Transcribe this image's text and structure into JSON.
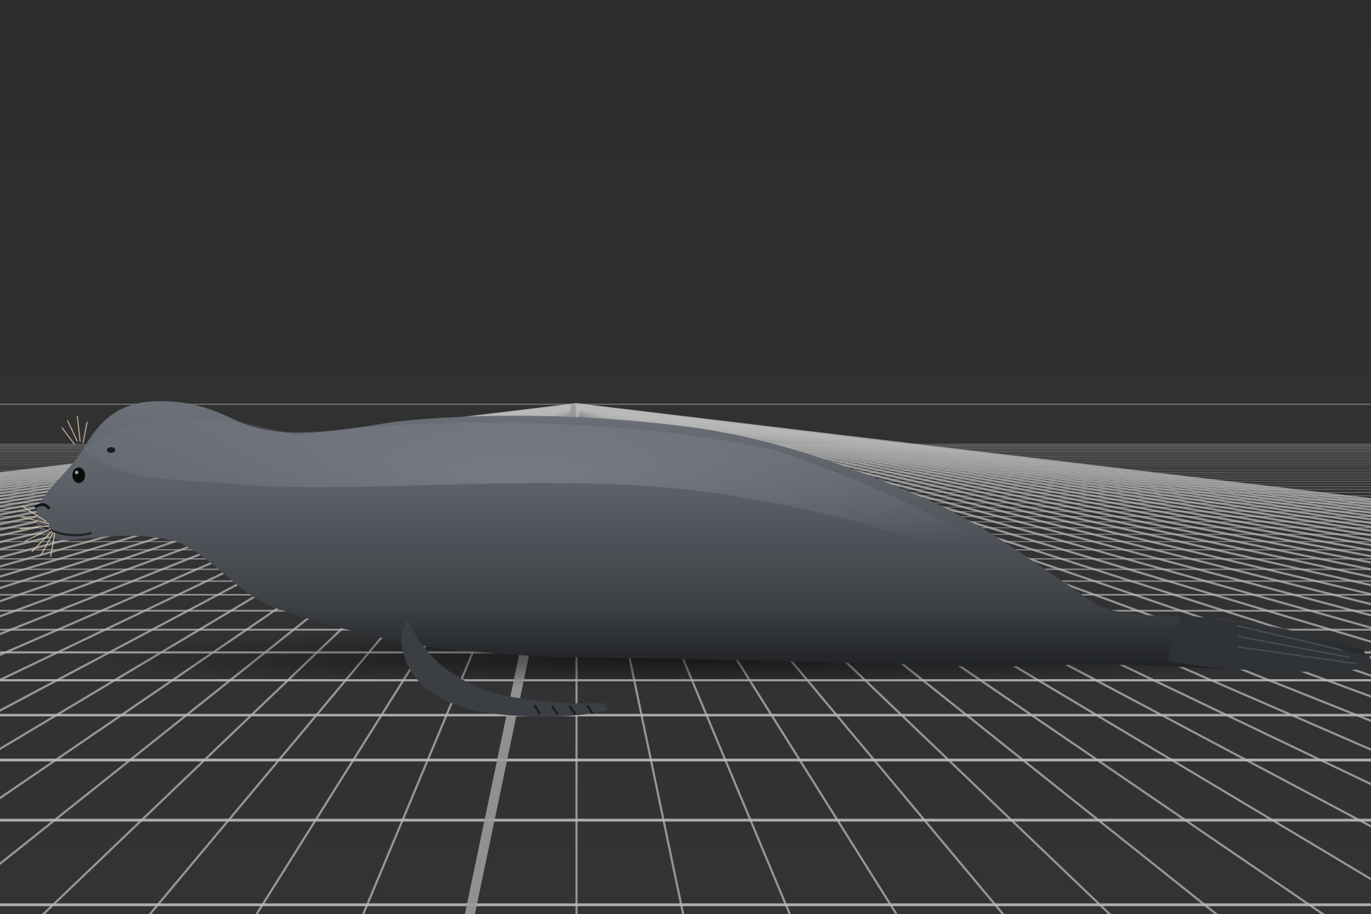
{
  "viewport": {
    "background_color": "#303030",
    "grid_color": "#b9b9b9",
    "grid_axis_color": "#9a9a9a",
    "subject": {
      "icon": "seal-model-icon",
      "body_color": "#4f5257",
      "highlight_color": "#8b9098",
      "shadow_color": "#202226",
      "whisker_color": "#d8c9a0"
    }
  }
}
